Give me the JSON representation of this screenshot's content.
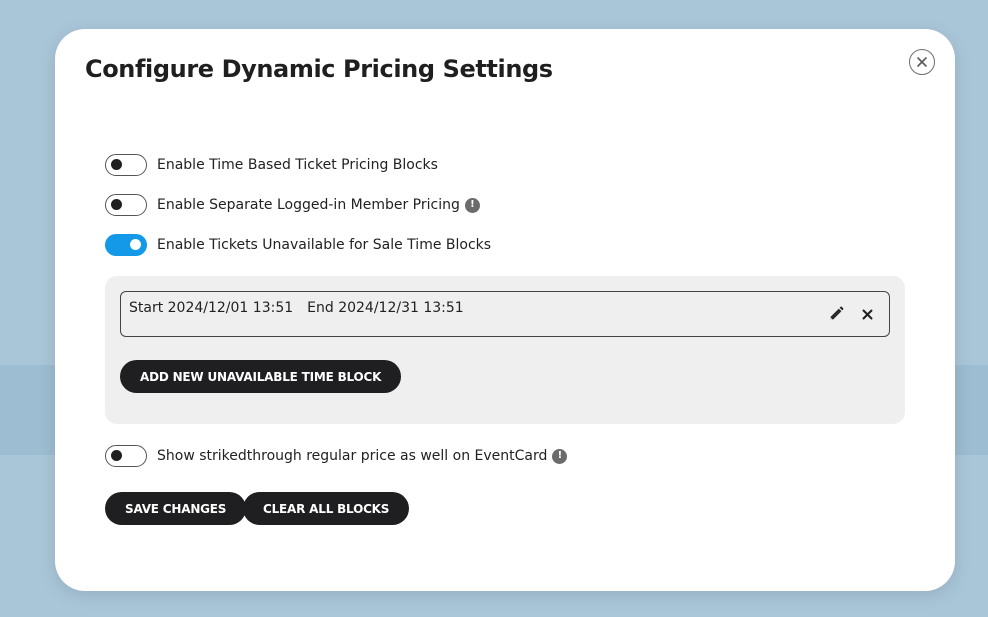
{
  "modal": {
    "title": "Configure Dynamic Pricing Settings"
  },
  "settings": {
    "time_based": {
      "label": "Enable Time Based Ticket Pricing Blocks",
      "enabled": false
    },
    "member_pricing": {
      "label": "Enable Separate Logged-in Member Pricing",
      "enabled": false,
      "info_icon": "!"
    },
    "unavailable_blocks": {
      "label": "Enable Tickets Unavailable for Sale Time Blocks",
      "enabled": true
    },
    "strikethrough": {
      "label": "Show strikedthrough regular price as well on EventCard",
      "enabled": false,
      "info_icon": "!"
    }
  },
  "unavailable_blocks": {
    "items": [
      {
        "start": "Start 2024/12/01 13:51",
        "end": "End 2024/12/31 13:51"
      }
    ],
    "add_label": "ADD NEW UNAVAILABLE TIME BLOCK"
  },
  "actions": {
    "save_label": "SAVE CHANGES",
    "clear_label": "CLEAR ALL BLOCKS"
  },
  "colors": {
    "accent": "#1499e8",
    "button_dark": "#1f1f22",
    "backdrop": "#a9c6d9"
  },
  "icons": {
    "close": "close-circle-icon",
    "info": "info-icon",
    "edit": "pencil-icon",
    "remove": "x-icon"
  }
}
